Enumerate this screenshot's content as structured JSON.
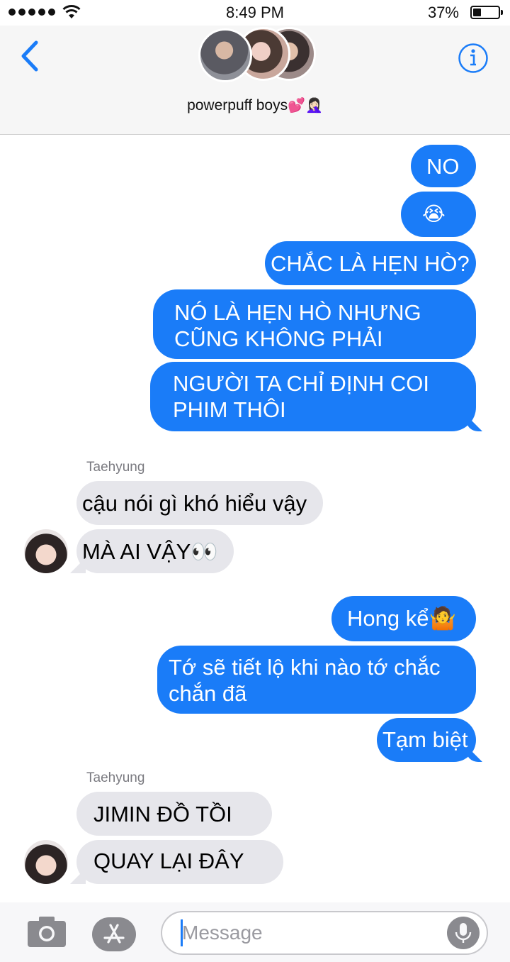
{
  "status_bar": {
    "time": "8:49 PM",
    "battery_percent": "37%",
    "battery_level": 0.37,
    "signal_bars": 5
  },
  "header": {
    "group_name": "powerpuff boys",
    "group_name_emoji": "💕🤦🏻‍♀️",
    "avatar_count": 3,
    "back_icon": "chevron-left-icon",
    "info_icon": "info-icon"
  },
  "messages": [
    {
      "dir": "out",
      "text": "NO"
    },
    {
      "dir": "out",
      "text": "😭"
    },
    {
      "dir": "out",
      "text": "CHẮC LÀ HẸN HÒ?"
    },
    {
      "dir": "out",
      "text": "NÓ LÀ HẸN HÒ NHƯNG"
    },
    {
      "dir": "out",
      "text": "CŨNG KHÔNG PHẢI"
    },
    {
      "dir": "out",
      "text": "NGƯỜI TA CHỈ ĐỊNH COI"
    },
    {
      "dir": "out",
      "text": "PHIM THÔI"
    },
    {
      "dir": "in",
      "sender": "Taehyung",
      "text": "cậu nói gì khó hiểu vậy"
    },
    {
      "dir": "in",
      "text": "MÀ AI VẬY👀"
    },
    {
      "dir": "out",
      "text": "Hong kể🤷"
    },
    {
      "dir": "out",
      "text": "Tớ sẽ tiết lộ khi nào tớ chắc"
    },
    {
      "dir": "out",
      "text": "chắn đã"
    },
    {
      "dir": "out",
      "text": "Tạm biệt"
    },
    {
      "dir": "in",
      "sender": "Taehyung",
      "text": "JIMIN ĐỒ TỒI"
    },
    {
      "dir": "in",
      "text": "QUAY LẠI ĐÂY"
    }
  ],
  "input_bar": {
    "placeholder": "Message",
    "value": "",
    "camera_icon": "camera-icon",
    "apps_icon": "app-store-icon",
    "mic_icon": "microphone-icon"
  },
  "colors": {
    "outgoing_bubble": "#1a7cf8",
    "incoming_bubble": "#e6e6eb",
    "accent": "#1a7cf8"
  }
}
